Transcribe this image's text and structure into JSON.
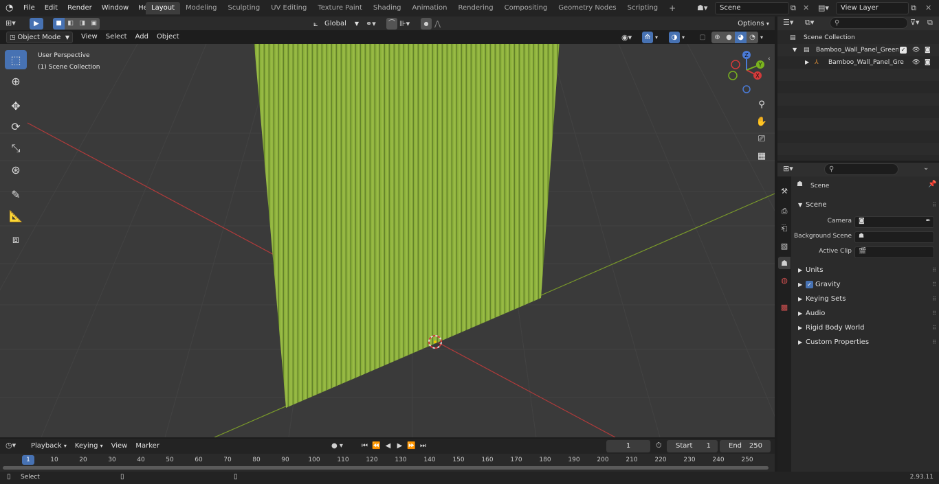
{
  "topbar": {
    "menus": [
      "File",
      "Edit",
      "Render",
      "Window",
      "Help"
    ],
    "workspaces": [
      "Layout",
      "Modeling",
      "Sculpting",
      "UV Editing",
      "Texture Paint",
      "Shading",
      "Animation",
      "Rendering",
      "Compositing",
      "Geometry Nodes",
      "Scripting"
    ],
    "active_workspace": "Layout",
    "add_tab": "+",
    "scene_name": "Scene",
    "view_layer": "View Layer"
  },
  "viewport_header": {
    "mode": "Object Mode",
    "menus": [
      "View",
      "Select",
      "Add",
      "Object"
    ],
    "orientation": "Global",
    "options": "Options"
  },
  "viewport": {
    "perspective": "User Perspective",
    "collection": "(1) Scene Collection",
    "gizmo_axes": {
      "x": "X",
      "y": "Y",
      "z": "Z"
    }
  },
  "outliner": {
    "root": "Scene Collection",
    "collection": "Bamboo_Wall_Panel_Green_C",
    "object": "Bamboo_Wall_Panel_Gre"
  },
  "properties": {
    "context": "Scene",
    "panel": "Scene",
    "fields": [
      {
        "label": "Camera"
      },
      {
        "label": "Background Scene"
      },
      {
        "label": "Active Clip"
      }
    ],
    "subpanels": [
      "Units",
      "Gravity",
      "Keying Sets",
      "Audio",
      "Rigid Body World",
      "Custom Properties"
    ],
    "gravity_checked": true
  },
  "timeline": {
    "menus": [
      "Playback",
      "Keying",
      "View",
      "Marker"
    ],
    "current_frame": "1",
    "start_label": "Start",
    "start": "1",
    "end_label": "End",
    "end": "250",
    "ticks": [
      "1",
      "10",
      "20",
      "30",
      "40",
      "50",
      "60",
      "70",
      "80",
      "90",
      "100",
      "110",
      "120",
      "130",
      "140",
      "150",
      "160",
      "170",
      "180",
      "190",
      "200",
      "210",
      "220",
      "230",
      "240",
      "250"
    ]
  },
  "statusbar": {
    "left": "Select",
    "version": "2.93.11"
  },
  "colors": {
    "accent": "#4772b3",
    "bamboo": "#9cc243",
    "grid_red": "#b23a3a",
    "grid_green": "#7a9a2a"
  }
}
